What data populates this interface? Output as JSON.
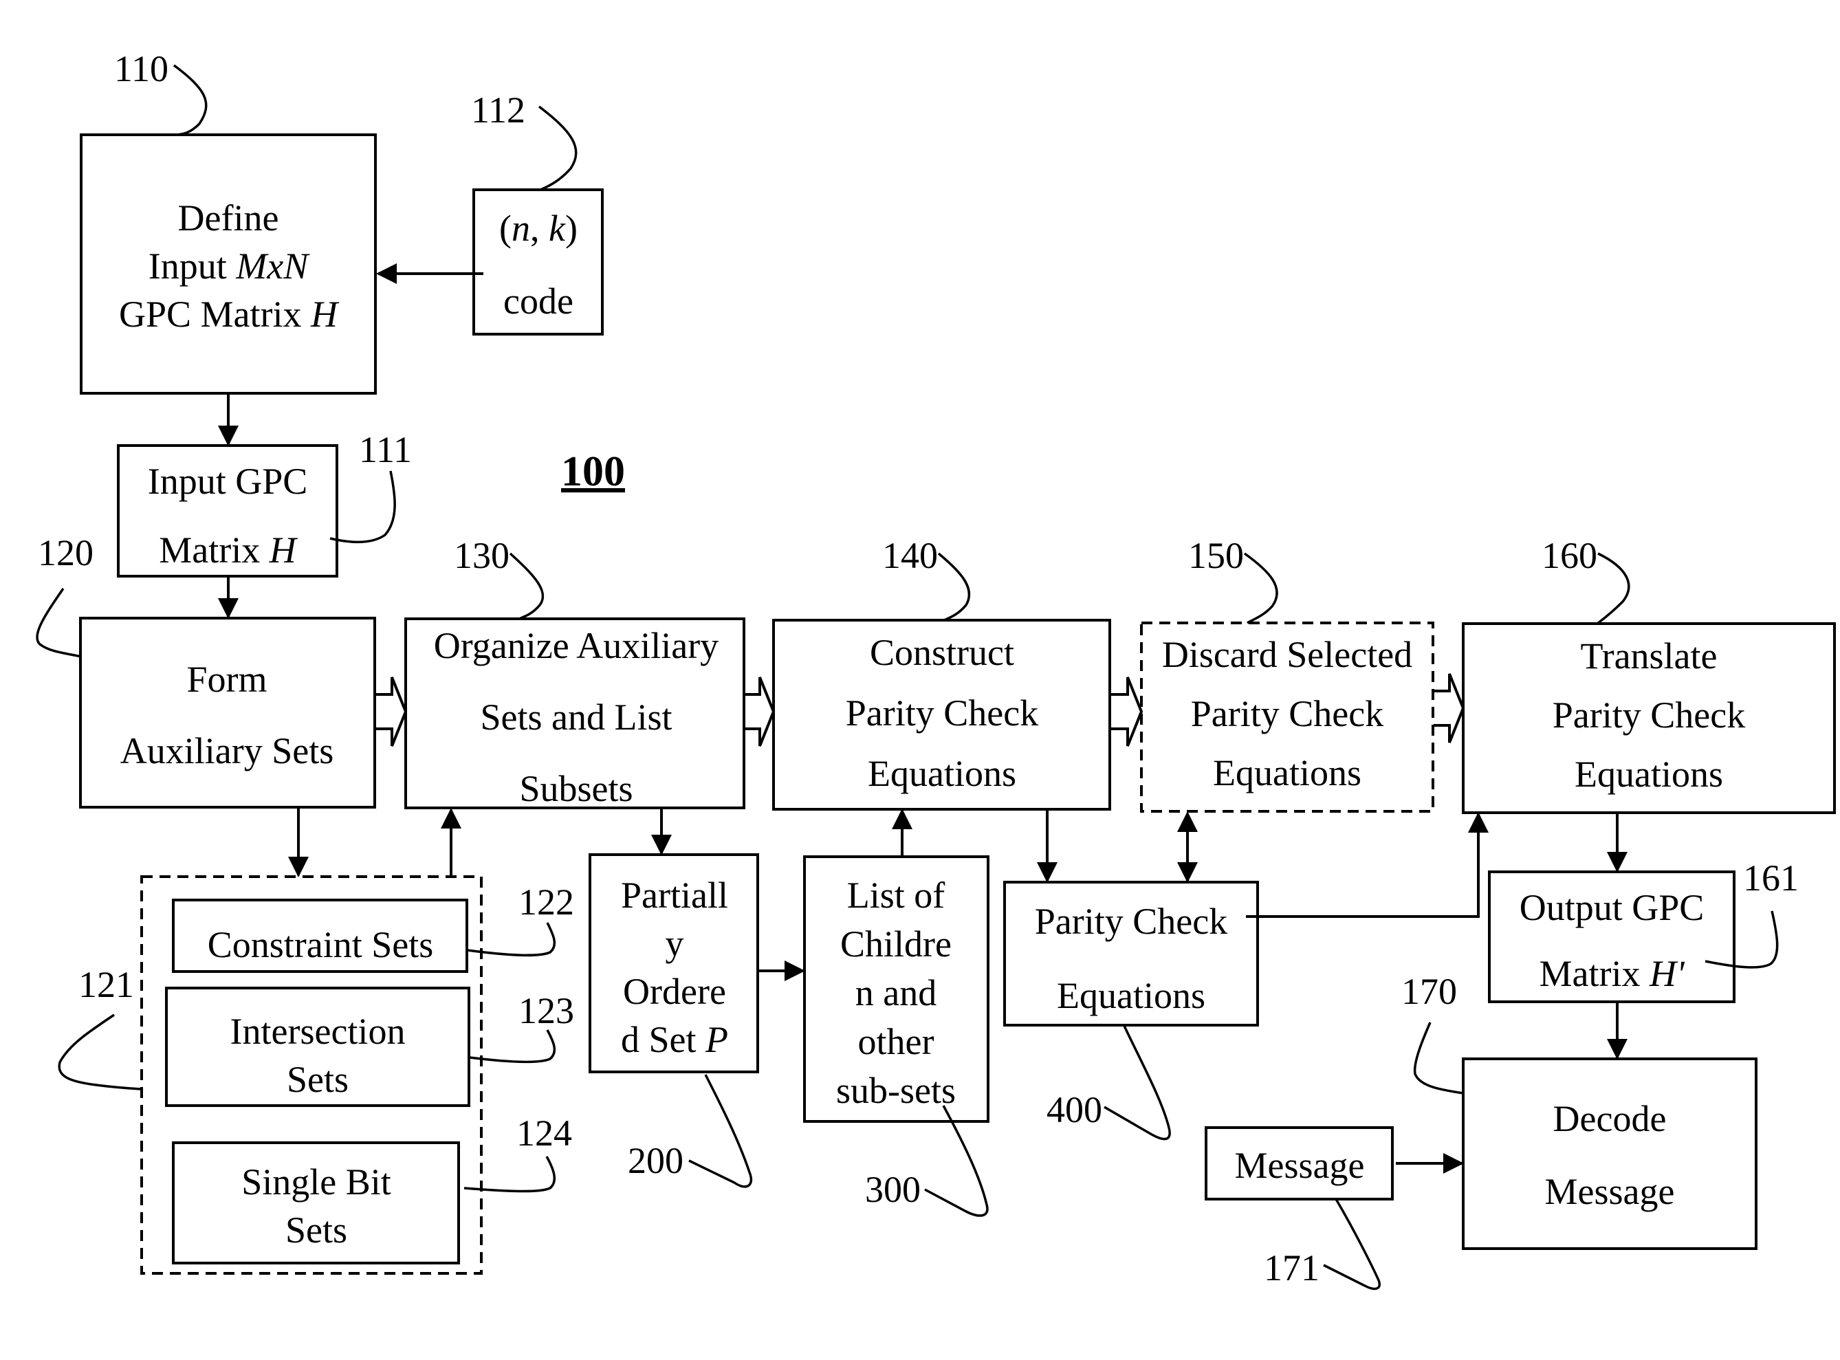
{
  "figure": {
    "figure_number": "100",
    "colors": {
      "ink": "#000000",
      "background": "#ffffff"
    }
  },
  "blocks": {
    "define_matrix": {
      "ref": "110",
      "lines": [
        {
          "parts": [
            {
              "text": "Define",
              "italic": false
            }
          ]
        },
        {
          "parts": [
            {
              "text": "Input ",
              "italic": false
            },
            {
              "text": "MxN",
              "italic": true
            }
          ]
        },
        {
          "parts": [
            {
              "text": "GPC Matrix ",
              "italic": false
            },
            {
              "text": "H",
              "italic": true
            }
          ]
        }
      ]
    },
    "code": {
      "ref": "112",
      "lines": [
        {
          "parts": [
            {
              "text": "(",
              "italic": false
            },
            {
              "text": "n",
              "italic": true
            },
            {
              "text": ", ",
              "italic": false
            },
            {
              "text": "k",
              "italic": true
            },
            {
              "text": ")",
              "italic": false
            }
          ]
        },
        {
          "parts": [
            {
              "text": "code",
              "italic": false
            }
          ]
        }
      ]
    },
    "input_matrix": {
      "ref": "111",
      "lines": [
        {
          "parts": [
            {
              "text": "Input GPC",
              "italic": false
            }
          ]
        },
        {
          "parts": [
            {
              "text": "Matrix ",
              "italic": false
            },
            {
              "text": "H",
              "italic": true
            }
          ]
        }
      ]
    },
    "form_aux": {
      "ref": "120",
      "lines": [
        {
          "parts": [
            {
              "text": "Form",
              "italic": false
            }
          ]
        },
        {
          "parts": [
            {
              "text": "Auxiliary Sets",
              "italic": false
            }
          ]
        }
      ]
    },
    "organize": {
      "ref": "130",
      "lines": [
        {
          "parts": [
            {
              "text": "Organize Auxiliary",
              "italic": false
            }
          ]
        },
        {
          "parts": [
            {
              "text": "Sets and List",
              "italic": false
            }
          ]
        },
        {
          "parts": [
            {
              "text": "Subsets",
              "italic": false
            }
          ]
        }
      ]
    },
    "construct": {
      "ref": "140",
      "lines": [
        {
          "parts": [
            {
              "text": "Construct",
              "italic": false
            }
          ]
        },
        {
          "parts": [
            {
              "text": "Parity Check",
              "italic": false
            }
          ]
        },
        {
          "parts": [
            {
              "text": "Equations",
              "italic": false
            }
          ]
        }
      ]
    },
    "discard": {
      "ref": "150",
      "lines": [
        {
          "parts": [
            {
              "text": "Discard Selected",
              "italic": false
            }
          ]
        },
        {
          "parts": [
            {
              "text": "Parity Check",
              "italic": false
            }
          ]
        },
        {
          "parts": [
            {
              "text": "Equations",
              "italic": false
            }
          ]
        }
      ]
    },
    "translate": {
      "ref": "160",
      "lines": [
        {
          "parts": [
            {
              "text": "Translate",
              "italic": false
            }
          ]
        },
        {
          "parts": [
            {
              "text": "Parity Check",
              "italic": false
            }
          ]
        },
        {
          "parts": [
            {
              "text": "Equations",
              "italic": false
            }
          ]
        }
      ]
    },
    "aux_group": {
      "ref": "121"
    },
    "constraint_sets": {
      "ref": "122",
      "lines": [
        {
          "parts": [
            {
              "text": "Constraint Sets",
              "italic": false
            }
          ]
        }
      ]
    },
    "intersection_sets": {
      "ref": "123",
      "lines": [
        {
          "parts": [
            {
              "text": "Intersection",
              "italic": false
            }
          ]
        },
        {
          "parts": [
            {
              "text": "Sets",
              "italic": false
            }
          ]
        }
      ]
    },
    "single_bit_sets": {
      "ref": "124",
      "lines": [
        {
          "parts": [
            {
              "text": "Single Bit",
              "italic": false
            }
          ]
        },
        {
          "parts": [
            {
              "text": "Sets",
              "italic": false
            }
          ]
        }
      ]
    },
    "poset": {
      "ref": "200",
      "lines": [
        {
          "parts": [
            {
              "text": "Partiall",
              "italic": false
            }
          ]
        },
        {
          "parts": [
            {
              "text": "y",
              "italic": false
            }
          ]
        },
        {
          "parts": [
            {
              "text": "Ordere",
              "italic": false
            }
          ]
        },
        {
          "parts": [
            {
              "text": "d Set ",
              "italic": false
            },
            {
              "text": "P",
              "italic": true
            }
          ]
        }
      ]
    },
    "children_list": {
      "ref": "300",
      "lines": [
        {
          "parts": [
            {
              "text": "List of",
              "italic": false
            }
          ]
        },
        {
          "parts": [
            {
              "text": "Childre",
              "italic": false
            }
          ]
        },
        {
          "parts": [
            {
              "text": "n and",
              "italic": false
            }
          ]
        },
        {
          "parts": [
            {
              "text": "other",
              "italic": false
            }
          ]
        },
        {
          "parts": [
            {
              "text": "sub-sets",
              "italic": false
            }
          ]
        }
      ]
    },
    "pc_equations": {
      "ref": "400",
      "lines": [
        {
          "parts": [
            {
              "text": "Parity Check",
              "italic": false
            }
          ]
        },
        {
          "parts": [
            {
              "text": "Equations",
              "italic": false
            }
          ]
        }
      ]
    },
    "output_matrix": {
      "ref": "161",
      "lines": [
        {
          "parts": [
            {
              "text": "Output GPC",
              "italic": false
            }
          ]
        },
        {
          "parts": [
            {
              "text": "Matrix ",
              "italic": false
            },
            {
              "text": "H'",
              "italic": true
            }
          ]
        }
      ]
    },
    "decode": {
      "ref": "170",
      "lines": [
        {
          "parts": [
            {
              "text": "Decode",
              "italic": false
            }
          ]
        },
        {
          "parts": [
            {
              "text": "Message",
              "italic": false
            }
          ]
        }
      ]
    },
    "message": {
      "ref": "171",
      "lines": [
        {
          "parts": [
            {
              "text": "Message",
              "italic": false
            }
          ]
        }
      ]
    }
  }
}
